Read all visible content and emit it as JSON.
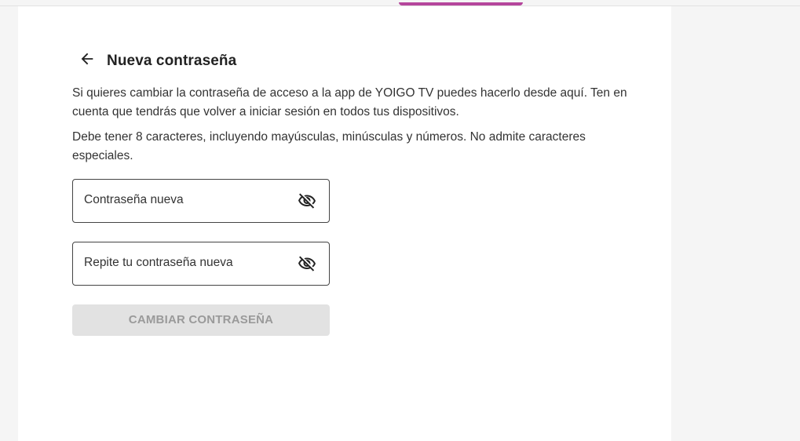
{
  "header": {
    "title": "Nueva contraseña",
    "back_icon": "arrow-left-icon"
  },
  "description": {
    "paragraph1": "Si quieres cambiar la contraseña de acceso a la app de YOIGO TV puedes hacerlo desde aquí. Ten en cuenta que tendrás que volver a iniciar sesión en todos tus dispositivos.",
    "paragraph2": "Debe tener 8 caracteres, incluyendo mayúsculas, minúsculas y números. No admite caracteres especiales."
  },
  "form": {
    "new_password_label": "Contraseña nueva",
    "repeat_password_label": "Repite tu contraseña nueva",
    "toggle_icon": "eye-off-icon",
    "submit_label": "CAMBIAR CONTRASEÑA"
  },
  "colors": {
    "accent": "#b5469c",
    "disabled_button_bg": "#e2e2e2",
    "disabled_button_text": "#9a9a9a"
  }
}
